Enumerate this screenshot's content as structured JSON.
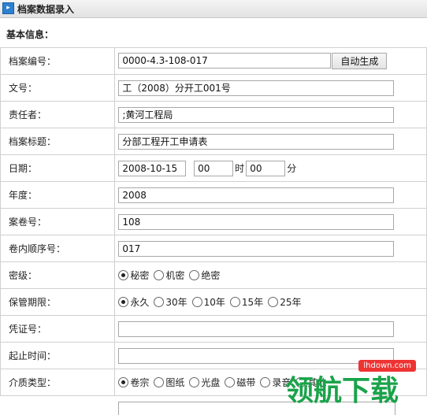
{
  "window": {
    "title": "档案数据录入",
    "icon": "arrow-icon"
  },
  "section": {
    "title": "基本信息："
  },
  "fields": {
    "code": {
      "label": "档案编号：",
      "value": "0000-4.3-108-017",
      "button": "自动生成"
    },
    "doc_no": {
      "label": "文号：",
      "value": "工（2008）分开工001号"
    },
    "responsible": {
      "label": "责任者：",
      "value": ";黄河工程局"
    },
    "title": {
      "label": "档案标题：",
      "value": "分部工程开工申请表"
    },
    "date": {
      "label": "日期：",
      "value": "2008-10-15",
      "hour": "00",
      "hour_unit": "时",
      "minute": "00",
      "minute_unit": "分"
    },
    "year": {
      "label": "年度：",
      "value": "2008"
    },
    "volume_no": {
      "label": "案卷号：",
      "value": "108"
    },
    "order_no": {
      "label": "卷内顺序号：",
      "value": "017"
    },
    "secrecy": {
      "label": "密级：",
      "options": [
        "秘密",
        "机密",
        "绝密"
      ],
      "selected": 0
    },
    "retention": {
      "label": "保管期限：",
      "options": [
        "永久",
        "30年",
        "10年",
        "15年",
        "25年"
      ],
      "selected": 0
    },
    "voucher": {
      "label": "凭证号：",
      "value": ""
    },
    "period": {
      "label": "起止时间：",
      "value": ""
    },
    "media": {
      "label": "介质类型：",
      "options": [
        "卷宗",
        "图纸",
        "光盘",
        "磁带",
        "录音",
        "其他"
      ],
      "selected": 0
    }
  },
  "watermark": {
    "text": "领航下载",
    "url": "lhdown.com",
    "accent": "#1aa34a"
  }
}
